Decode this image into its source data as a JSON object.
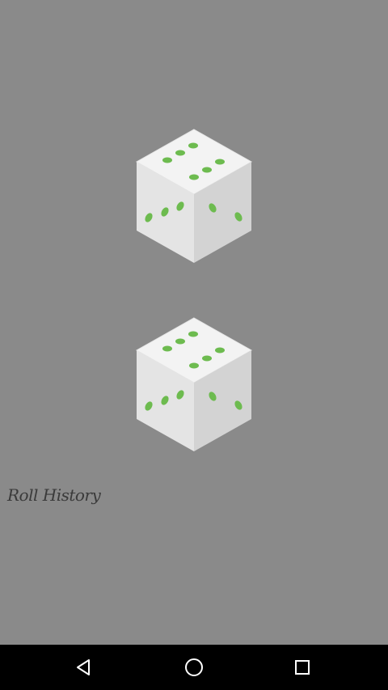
{
  "dice": [
    {
      "value": 6
    },
    {
      "value": 6
    }
  ],
  "history": {
    "label": "Roll History"
  },
  "colors": {
    "background": "#8a8a8a",
    "pip": "#6dbb4f",
    "die_top": "#f2f2f2",
    "die_left": "#e3e3e3",
    "die_right": "#d2d2d2",
    "navbar": "#000000"
  },
  "navbar": {
    "icons": [
      "back-icon",
      "home-icon",
      "recents-icon"
    ]
  }
}
